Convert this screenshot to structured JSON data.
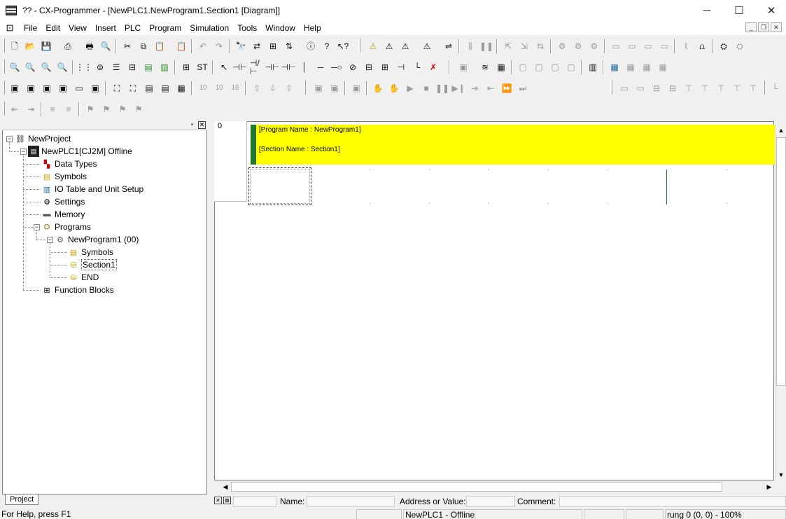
{
  "window": {
    "title": "?? - CX-Programmer - [NewPLC1.NewProgram1.Section1 [Diagram]]",
    "minimize_icon": "minimize-icon",
    "maximize_icon": "maximize-icon",
    "close_icon": "close-icon"
  },
  "menu": {
    "items": [
      "File",
      "Edit",
      "View",
      "Insert",
      "PLC",
      "Program",
      "Simulation",
      "Tools",
      "Window",
      "Help"
    ]
  },
  "tree": {
    "items": [
      {
        "label": "NewProject",
        "icon": "project-icon"
      },
      {
        "label": "NewPLC1[CJ2M] Offline",
        "icon": "plc-icon"
      },
      {
        "label": "Data Types",
        "icon": "data-types-icon"
      },
      {
        "label": "Symbols",
        "icon": "symbols-icon"
      },
      {
        "label": "IO Table and Unit Setup",
        "icon": "io-table-icon"
      },
      {
        "label": "Settings",
        "icon": "settings-icon"
      },
      {
        "label": "Memory",
        "icon": "memory-icon"
      },
      {
        "label": "Programs",
        "icon": "programs-icon"
      },
      {
        "label": "NewProgram1 (00)",
        "icon": "program-icon"
      },
      {
        "label": "Symbols",
        "icon": "symbols-icon"
      },
      {
        "label": "Section1",
        "icon": "section-icon"
      },
      {
        "label": "END",
        "icon": "section-icon"
      },
      {
        "label": "Function Blocks",
        "icon": "function-blocks-icon"
      }
    ],
    "tab_label": "Project"
  },
  "diagram": {
    "rung_number": "0",
    "program_name": "[Program Name : NewProgram1]",
    "section_name": "[Section Name : Section1]",
    "rail_color": "#1f7a2e",
    "header_color": "#ffff00"
  },
  "watch": {
    "name_label": "Name:",
    "address_label": "Address or Value:",
    "comment_label": "Comment:"
  },
  "status": {
    "help": "For Help, press F1",
    "plc_state": "NewPLC1 - Offline",
    "position": "rung 0 (0, 0)  - 100%"
  }
}
